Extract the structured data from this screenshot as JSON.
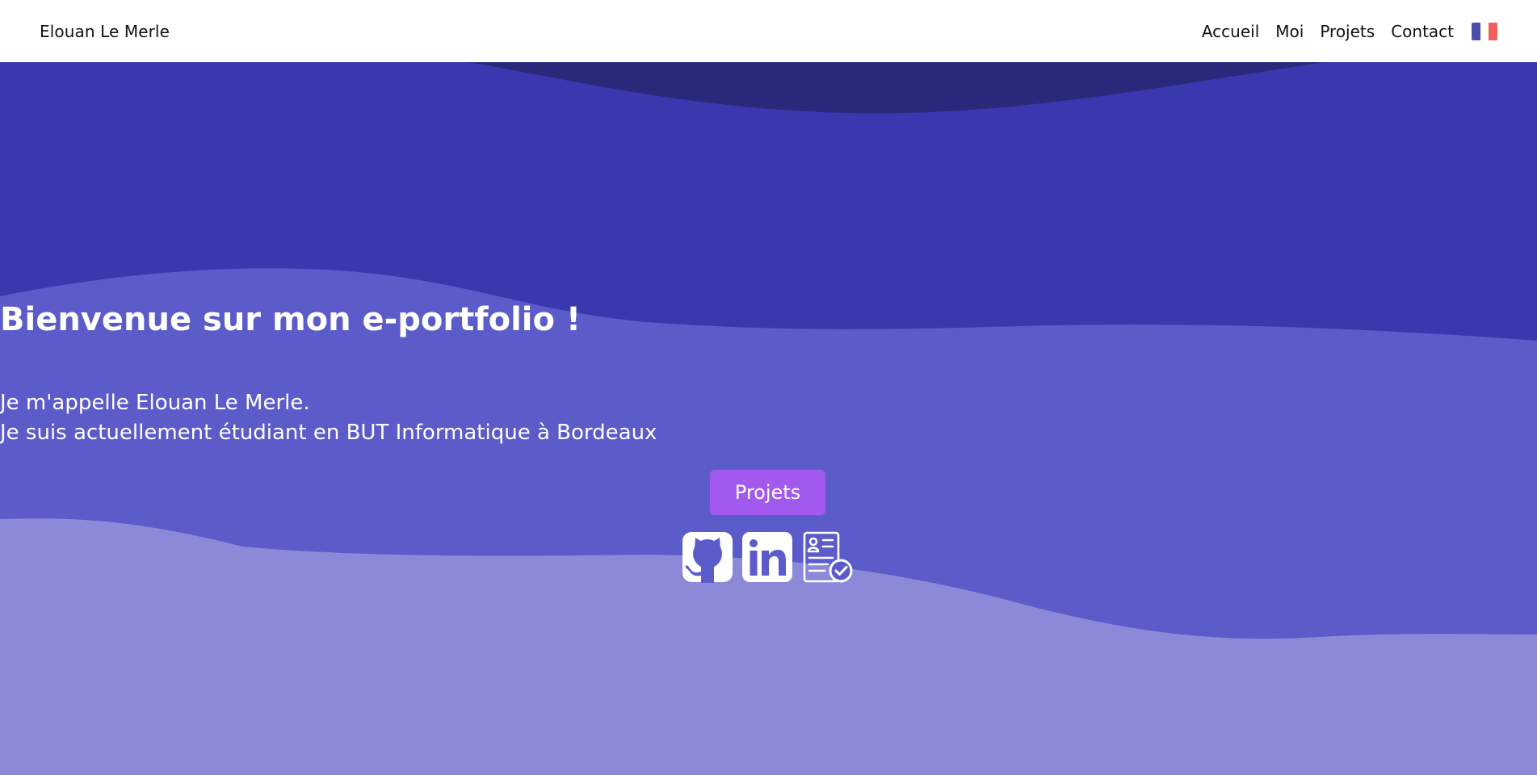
{
  "header": {
    "brand": "Elouan Le Merle",
    "nav": [
      "Accueil",
      "Moi",
      "Projets",
      "Contact"
    ],
    "language_flag": "french-flag-icon"
  },
  "hero": {
    "title": "Bienvenue sur mon e-portfolio !",
    "intro_line1": "Je m'appelle Elouan Le Merle.",
    "intro_line2": "Je suis actuellement étudiant en BUT Informatique à Bordeaux",
    "cta_label": "Projets",
    "social_icons": [
      "github-icon",
      "linkedin-icon",
      "resume-icon"
    ]
  },
  "colors": {
    "wave_dark": "#28297a",
    "wave_top": "#3938ae",
    "wave_mid": "#5c5bca",
    "wave_bottom": "#8b89d8",
    "cta": "#a259ee",
    "flag_blue": "#4b4fa8",
    "flag_red": "#f25d5d"
  }
}
